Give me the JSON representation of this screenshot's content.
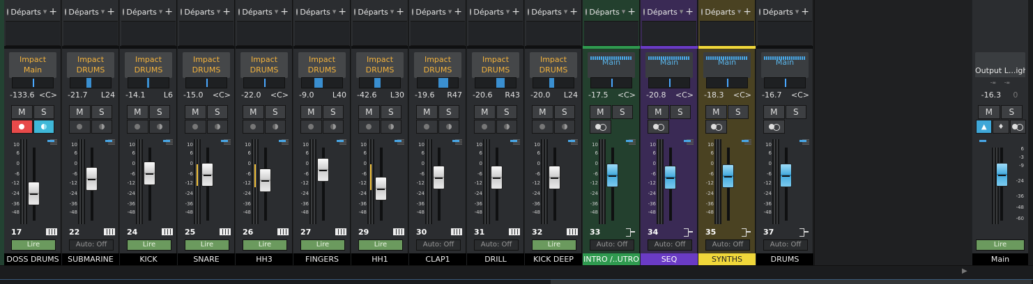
{
  "send_label": "Départs",
  "route_top": "Impact",
  "auto": {
    "read": "Lire",
    "off": "Auto: Off"
  },
  "ms": {
    "mute": "M",
    "solo": "S"
  },
  "scale_labels": [
    "10",
    "6",
    "0",
    "-6",
    "-12",
    "-24",
    "-36",
    "-48"
  ],
  "main_scale_labels": [
    "6",
    "-3",
    "-9",
    "-24",
    "-36",
    "-48",
    "-60"
  ],
  "channels": [
    {
      "number": "17",
      "name": "DOSS DRUMS",
      "route": "Main",
      "volume": "-133.6",
      "pan": "<C>",
      "tint": "",
      "name_style": "",
      "type": "instrument",
      "auto": "read",
      "armed": true,
      "fader_pos": 0.78,
      "peak": null
    },
    {
      "number": "22",
      "name": "SUBMARINE",
      "route": "DRUMS",
      "volume": "-21.7",
      "pan": "L24",
      "tint": "",
      "name_style": "",
      "type": "instrument",
      "auto": "off",
      "armed": false,
      "fader_pos": 0.5,
      "peak": null
    },
    {
      "number": "24",
      "name": "KICK",
      "route": "DRUMS",
      "volume": "-14.1",
      "pan": "L6",
      "tint": "",
      "name_style": "",
      "type": "instrument",
      "auto": "read",
      "armed": false,
      "fader_pos": 0.4,
      "peak": null
    },
    {
      "number": "25",
      "name": "SNARE",
      "route": "DRUMS",
      "volume": "-15.0",
      "pan": "<C>",
      "tint": "",
      "name_style": "",
      "type": "instrument",
      "auto": "read",
      "armed": false,
      "fader_pos": 0.42,
      "peak": [
        0.22,
        0.5
      ]
    },
    {
      "number": "26",
      "name": "HH3",
      "route": "DRUMS",
      "volume": "-22.0",
      "pan": "<C>",
      "tint": "",
      "name_style": "",
      "type": "instrument",
      "auto": "read",
      "armed": false,
      "fader_pos": 0.53,
      "peak": [
        0.22,
        0.52
      ]
    },
    {
      "number": "27",
      "name": "FINGERS",
      "route": "DRUMS",
      "volume": "-9.0",
      "pan": "L40",
      "tint": "",
      "name_style": "",
      "type": "instrument",
      "auto": "read",
      "armed": false,
      "fader_pos": 0.33,
      "peak": null
    },
    {
      "number": "29",
      "name": "HH1",
      "route": "DRUMS",
      "volume": "-42.6",
      "pan": "L30",
      "tint": "",
      "name_style": "",
      "type": "instrument",
      "auto": "read",
      "armed": false,
      "fader_pos": 0.68,
      "peak": [
        0.22,
        0.55
      ]
    },
    {
      "number": "30",
      "name": "CLAP1",
      "route": "DRUMS",
      "volume": "-19.6",
      "pan": "R47",
      "tint": "",
      "name_style": "",
      "type": "instrument",
      "auto": "off",
      "armed": false,
      "fader_pos": 0.47,
      "peak": null
    },
    {
      "number": "31",
      "name": "DRILL",
      "route": "DRUMS",
      "volume": "-20.6",
      "pan": "R43",
      "tint": "",
      "name_style": "",
      "type": "instrument",
      "auto": "off",
      "armed": false,
      "fader_pos": 0.48,
      "peak": null
    },
    {
      "number": "32",
      "name": "KICK DEEP",
      "route": "DRUMS",
      "volume": "-20.0",
      "pan": "L24",
      "tint": "",
      "name_style": "",
      "type": "instrument",
      "auto": "read",
      "armed": false,
      "fader_pos": 0.47,
      "peak": null
    },
    {
      "number": "33",
      "name": "INTRO /..UTRO",
      "route": "Main",
      "volume": "-17.5",
      "pan": "<C>",
      "tint": "tint-intro",
      "name_style": "green",
      "type": "bus",
      "auto": "off",
      "armed": false,
      "fader_pos": 0.44,
      "peak": null
    },
    {
      "number": "34",
      "name": "SEQ",
      "route": "Main",
      "volume": "-20.8",
      "pan": "<C>",
      "tint": "tint-seq",
      "name_style": "purple",
      "type": "bus",
      "auto": "off",
      "armed": false,
      "fader_pos": 0.47,
      "peak": null
    },
    {
      "number": "35",
      "name": "SYNTHS",
      "route": "Main",
      "volume": "-18.3",
      "pan": "<C>",
      "tint": "tint-synth",
      "name_style": "yellow",
      "type": "bus",
      "auto": "off",
      "armed": false,
      "fader_pos": 0.45,
      "peak": null
    },
    {
      "number": "37",
      "name": "DRUMS",
      "route": "Main",
      "volume": "-16.7",
      "pan": "<C>",
      "tint": "",
      "name_style": "",
      "type": "bus",
      "auto": "off",
      "armed": false,
      "fader_pos": 0.43,
      "peak": null
    }
  ],
  "main": {
    "name": "Main",
    "route": "Output L...ight",
    "pan_l": "-∞",
    "pan_r": "-∞",
    "volume": "-16.3",
    "peak": "0",
    "auto": "Lire",
    "fader_pos": 0.42
  },
  "colors": {
    "green": "#2f9a4f",
    "purple": "#6a3bc5",
    "yellow": "#f0d73a",
    "read": "#6b9a5e",
    "blue": "#48a8e8",
    "orange": "#f3b23c"
  }
}
